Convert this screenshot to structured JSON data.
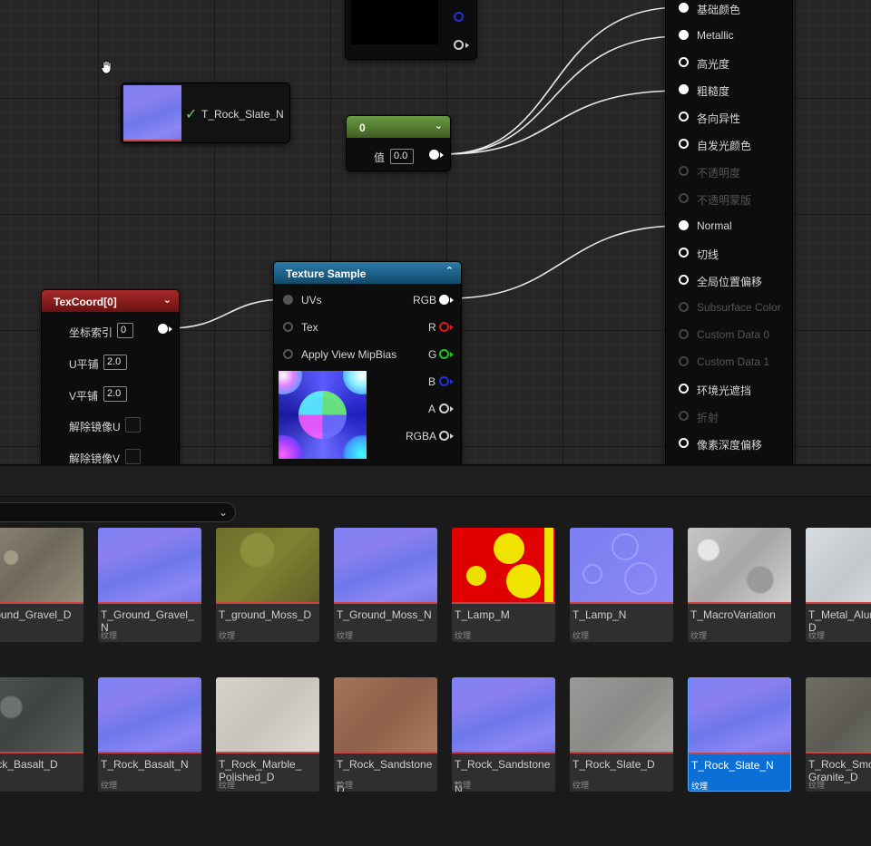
{
  "graph": {
    "texture_ref_node": {
      "label": "T_Rock_Slate_N",
      "check": "✓"
    },
    "constant_node": {
      "title": "0",
      "value_label": "值",
      "value": "0.0"
    },
    "texcoord_node": {
      "title": "TexCoord[0]",
      "rows": [
        {
          "label": "坐标索引",
          "value": "0"
        },
        {
          "label": "U平铺",
          "value": "2.0"
        },
        {
          "label": "V平铺",
          "value": "2.0"
        },
        {
          "label": "解除镜像U",
          "value": ""
        },
        {
          "label": "解除镜像V",
          "value": ""
        }
      ]
    },
    "texture_sample_node": {
      "title": "Texture Sample",
      "inputs": [
        "UVs",
        "Tex",
        "Apply View MipBias"
      ],
      "outputs": [
        "RGB",
        "R",
        "G",
        "B",
        "A",
        "RGBA"
      ],
      "output_colors": [
        "#ffffff",
        "#d01d1d",
        "#22c02a",
        "#2233cc",
        "#cfcfcf",
        "#ffffff"
      ]
    },
    "material_node": {
      "pins": [
        {
          "label": "基础颜色",
          "connected": true,
          "enabled": true
        },
        {
          "label": "Metallic",
          "connected": true,
          "enabled": true
        },
        {
          "label": "高光度",
          "connected": false,
          "enabled": true
        },
        {
          "label": "粗糙度",
          "connected": true,
          "enabled": true
        },
        {
          "label": "各向异性",
          "connected": false,
          "enabled": true
        },
        {
          "label": "自发光颜色",
          "connected": false,
          "enabled": true
        },
        {
          "label": "不透明度",
          "connected": false,
          "enabled": false
        },
        {
          "label": "不透明蒙版",
          "connected": false,
          "enabled": false
        },
        {
          "label": "Normal",
          "connected": true,
          "enabled": true
        },
        {
          "label": "切线",
          "connected": false,
          "enabled": true
        },
        {
          "label": "全局位置偏移",
          "connected": false,
          "enabled": true
        },
        {
          "label": "Subsurface Color",
          "connected": false,
          "enabled": false
        },
        {
          "label": "Custom Data 0",
          "connected": false,
          "enabled": false
        },
        {
          "label": "Custom Data 1",
          "connected": false,
          "enabled": false
        },
        {
          "label": "环境光遮挡",
          "connected": false,
          "enabled": true
        },
        {
          "label": "折射",
          "connected": false,
          "enabled": false
        },
        {
          "label": "像素深度偏移",
          "connected": false,
          "enabled": true
        }
      ]
    }
  },
  "content_browser": {
    "asset_type": "纹理",
    "rows": [
      [
        {
          "name": "T_Ground_Gravel_D",
          "visible_name": "Ground_Gravel_D",
          "tex": "tex-gravel"
        },
        {
          "name": "T_Ground_Gravel_N",
          "visible_name": "T_Ground_Gravel_N",
          "tex": "tex-normal"
        },
        {
          "name": "T_ground_Moss_D",
          "visible_name": "T_ground_Moss_D",
          "tex": "tex-moss"
        },
        {
          "name": "T_Ground_Moss_N",
          "visible_name": "T_Ground_Moss_N",
          "tex": "tex-normal"
        },
        {
          "name": "T_Lamp_M",
          "visible_name": "T_Lamp_M",
          "tex": "tex-lampm"
        },
        {
          "name": "T_Lamp_N",
          "visible_name": "T_Lamp_N",
          "tex": "tex-lampn"
        },
        {
          "name": "T_MacroVariation",
          "visible_name": "T_MacroVariation",
          "tex": "tex-macro"
        },
        {
          "name": "T_Metal_Alum...D",
          "visible_name": "T_Metal_Alum\nD",
          "tex": "tex-metal"
        }
      ],
      [
        {
          "name": "T_Rock_Basalt_D",
          "visible_name": "Rock_Basalt_D",
          "tex": "tex-basalt"
        },
        {
          "name": "T_Rock_Basalt_N",
          "visible_name": "T_Rock_Basalt_N",
          "tex": "tex-normal"
        },
        {
          "name": "T_Rock_Marble_Polished_D",
          "visible_name": "T_Rock_Marble_\nPolished_D",
          "tex": "tex-marble"
        },
        {
          "name": "T_Rock_Sandstone_D",
          "visible_name": "T_Rock_Sandstone_\nD",
          "tex": "tex-sandstone"
        },
        {
          "name": "T_Rock_Sandstone_N",
          "visible_name": "T_Rock_Sandstone_\nN",
          "tex": "tex-normal"
        },
        {
          "name": "T_Rock_Slate_D",
          "visible_name": "T_Rock_Slate_D",
          "tex": "tex-slated"
        },
        {
          "name": "T_Rock_Slate_N",
          "visible_name": "T_Rock_Slate_N",
          "tex": "tex-normal",
          "selected": true
        },
        {
          "name": "T_Rock_Smooth_Granite_D",
          "visible_name": "T_Rock_Smo\nGranite_D",
          "tex": "tex-granite"
        }
      ]
    ]
  },
  "colors": {
    "accent": "#0b6fd6",
    "constant_header": "#5d8a36",
    "texcoord_header": "#8a1c1c",
    "texture_sample_header": "#1c5f86"
  }
}
